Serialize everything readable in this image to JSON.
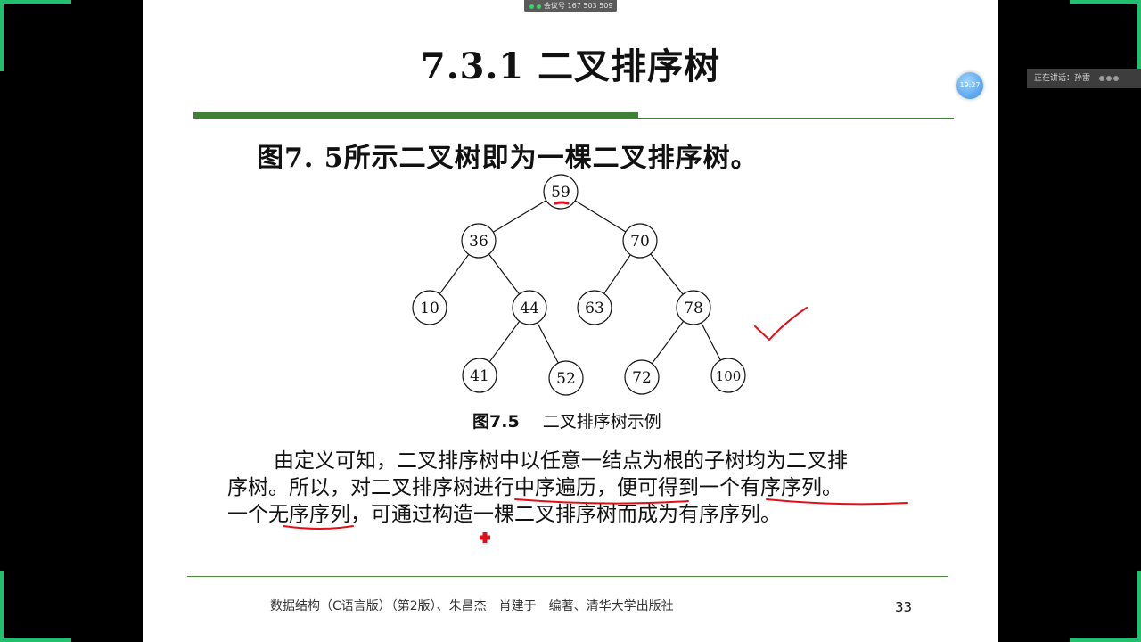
{
  "meeting": {
    "label": "会议号 167 503 509"
  },
  "status_bar": {
    "label": "正在讲话：孙雷"
  },
  "timer": {
    "label": "19:27"
  },
  "slide": {
    "title": "7.3.1  二叉排序树",
    "intro": "图7. 5所示二叉树即为一棵二叉排序树。",
    "caption_number": "图7.5",
    "caption_text": "二叉排序树示例",
    "paragraph": [
      "由定义可知，二叉排序树中以任意一结点为根的子树均为二叉排",
      "序树。所以，对二叉排序树进行中序遍历，便可得到一个有序序列。",
      "一个无序序列，可通过构造一棵二叉排序树而成为有序序列。"
    ],
    "footer": "数据结构（C语言版）（第2版）、朱昌杰　肖建于　编著、清华大学出版社",
    "page_number": "33"
  },
  "tree": {
    "nodes": [
      {
        "id": "59",
        "label": "59"
      },
      {
        "id": "36",
        "label": "36"
      },
      {
        "id": "70",
        "label": "70"
      },
      {
        "id": "10",
        "label": "10"
      },
      {
        "id": "44",
        "label": "44"
      },
      {
        "id": "63",
        "label": "63"
      },
      {
        "id": "78",
        "label": "78"
      },
      {
        "id": "41",
        "label": "41"
      },
      {
        "id": "52",
        "label": "52"
      },
      {
        "id": "72",
        "label": "72"
      },
      {
        "id": "100",
        "label": "100"
      }
    ],
    "edges": [
      [
        "59",
        "36"
      ],
      [
        "59",
        "70"
      ],
      [
        "36",
        "10"
      ],
      [
        "36",
        "44"
      ],
      [
        "70",
        "63"
      ],
      [
        "70",
        "78"
      ],
      [
        "44",
        "41"
      ],
      [
        "44",
        "52"
      ],
      [
        "78",
        "72"
      ],
      [
        "78",
        "100"
      ]
    ]
  },
  "colors": {
    "accent_green": "#3f7f36",
    "annotation_red": "#e0101a",
    "corner_green": "#20c070"
  }
}
